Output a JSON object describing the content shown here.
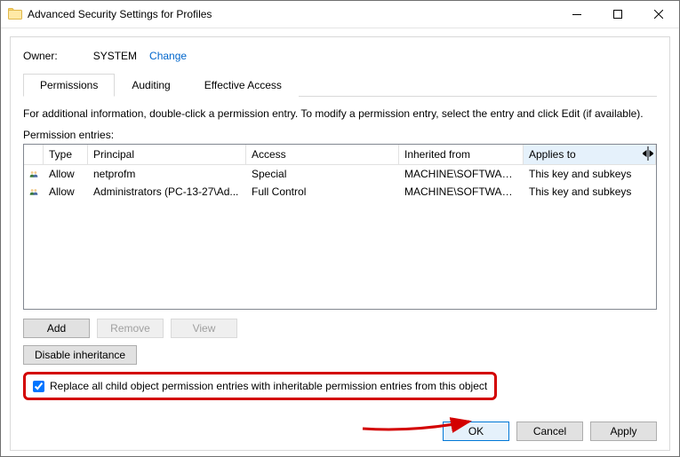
{
  "titlebar": {
    "icon": "folder-icon",
    "title": "Advanced Security Settings for Profiles"
  },
  "owner": {
    "label": "Owner:",
    "value": "SYSTEM",
    "change": "Change"
  },
  "tabs": [
    {
      "label": "Permissions",
      "active": true
    },
    {
      "label": "Auditing",
      "active": false
    },
    {
      "label": "Effective Access",
      "active": false
    }
  ],
  "info_text": "For additional information, double-click a permission entry. To modify a permission entry, select the entry and click Edit (if available).",
  "entries_label": "Permission entries:",
  "columns": {
    "type": "Type",
    "principal": "Principal",
    "access": "Access",
    "inherited": "Inherited from",
    "applies": "Applies to"
  },
  "rows": [
    {
      "type": "Allow",
      "principal": "netprofm",
      "access": "Special",
      "inherited": "MACHINE\\SOFTWARE...",
      "applies": "This key and subkeys"
    },
    {
      "type": "Allow",
      "principal": "Administrators (PC-13-27\\Ad...",
      "access": "Full Control",
      "inherited": "MACHINE\\SOFTWARE...",
      "applies": "This key and subkeys"
    }
  ],
  "buttons": {
    "add": "Add",
    "remove": "Remove",
    "view": "View",
    "disable_inh": "Disable inheritance"
  },
  "checkbox": {
    "checked": true,
    "label": "Replace all child object permission entries with inheritable permission entries from this object"
  },
  "footer": {
    "ok": "OK",
    "cancel": "Cancel",
    "apply": "Apply"
  },
  "accent_color": "#0078d7",
  "callout_color": "#d30000"
}
